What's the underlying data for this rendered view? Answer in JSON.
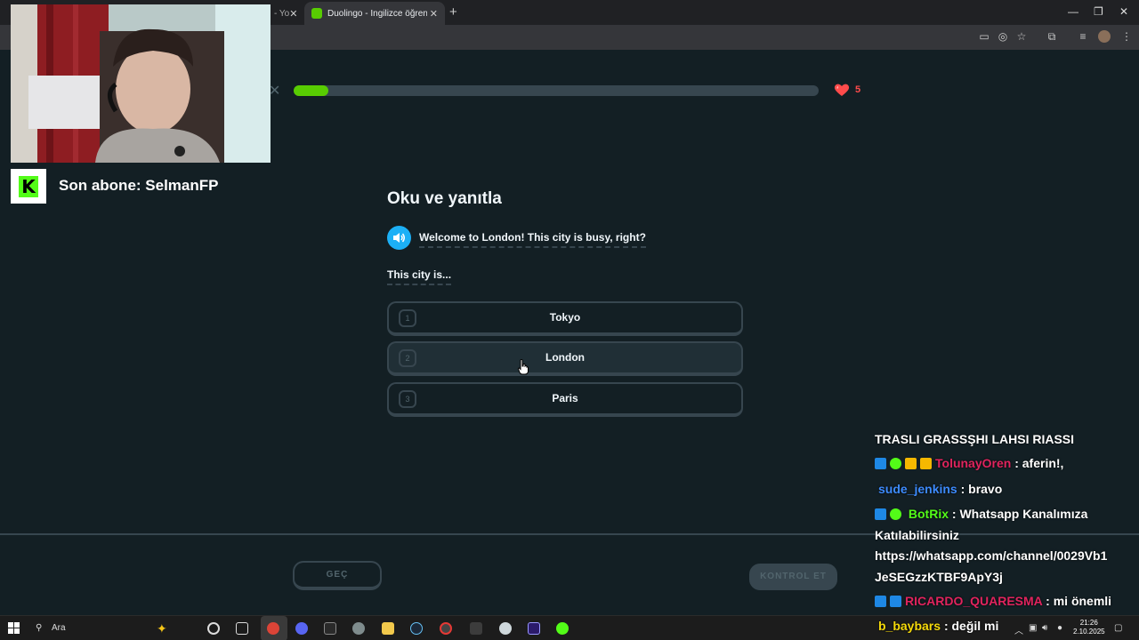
{
  "browser": {
    "tabs": [
      {
        "label": "- Yo"
      },
      {
        "label": "Duolingo - İngilizce öğrenmenin..."
      }
    ],
    "new_tab": "+",
    "window_controls": {
      "minimize": "—",
      "maximize": "❐",
      "close": "✕"
    }
  },
  "lesson": {
    "progress": 0.066,
    "hearts": "5",
    "close_icon": "✕",
    "title": "Oku ve yanıtla",
    "prompt": "Welcome to London! This city is busy, right?",
    "sub_prompt": "This city is...",
    "options": [
      {
        "number": "1",
        "label": "Tokyo"
      },
      {
        "number": "2",
        "label": "London"
      },
      {
        "number": "3",
        "label": "Paris"
      }
    ],
    "skip_label": "GEÇ",
    "check_label": "KONTROL ET"
  },
  "overlay": {
    "last_subscriber": "Son abone: SelmanFP",
    "logo_letter": "K"
  },
  "chat": {
    "messages": [
      {
        "user": "",
        "text": "TRASLI GRASSŞHI LAHSI RIASSI",
        "color": "#ffffff"
      },
      {
        "user": "TolunayOren",
        "text": ": aferin!,",
        "color": "#e0245e"
      },
      {
        "user": "sude_jenkins",
        "text": ": bravo",
        "color": "#3d8bfd"
      },
      {
        "user": "BotRix",
        "text": ": Whatsapp Kanalımıza",
        "color": "#53fc18"
      },
      {
        "user": "",
        "text": "Katılabilirsiniz",
        "color": "#ffffff"
      },
      {
        "user": "",
        "text": "https://whatsapp.com/channel/0029Vb1",
        "color": "#ffffff"
      },
      {
        "user": "",
        "text": "JeSEGzzKTBF9ApY3j",
        "color": "#ffffff"
      },
      {
        "user": "RICARDO_QUARESMA",
        "text": ": mi önemli",
        "color": "#e0245e"
      },
      {
        "user": "b_baybars",
        "text": ": değil mi",
        "color": "#f5d90a"
      }
    ]
  },
  "taskbar": {
    "search_placeholder": "Ara",
    "time": "21:26",
    "date": "2.10.2025"
  },
  "colors": {
    "background": "#131f24",
    "accent_green": "#58cc02",
    "border": "#37464f",
    "speaker_blue": "#1cb0f6",
    "heart_red": "#ff4b4b"
  }
}
